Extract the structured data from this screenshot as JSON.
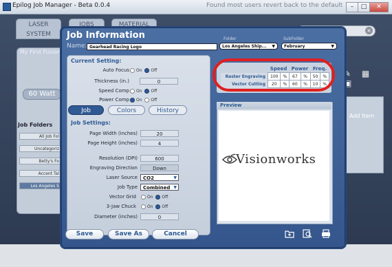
{
  "window": {
    "title": "Epilog Job Manager - Beta 0.0.4",
    "hint_text": "Found most users revert back to the default",
    "controls": {
      "minimize": "–",
      "maximize": "□",
      "close": "✕"
    }
  },
  "top_tabs": [
    {
      "line1": "LASER",
      "line2": "SYSTEM"
    },
    {
      "line1": "JOBS",
      "line2": ""
    },
    {
      "line1": "MATERIAL",
      "line2": ""
    }
  ],
  "background": {
    "side_tag": "My First Fusion",
    "watt_button": "60 Watt",
    "folders_title": "Job Folders",
    "folders": [
      "All Job Fol",
      "Uncategoriz",
      "Betty's Fo",
      "Accent Tal",
      "Los Angeles S"
    ],
    "right_text": "Add Item"
  },
  "dialog": {
    "title": "Job Information",
    "name_label": "Name:",
    "name_value": "Gearhead Racing Logo",
    "folder_label": "Folder",
    "folder_value": "Los Angeles Ship...",
    "subfolder_label": "SubFolder",
    "subfolder_value": "February",
    "current_setting": {
      "heading": "Current Setting:",
      "auto_focus": {
        "label": "Auto Focus",
        "on": "On",
        "off": "Off",
        "selected": "Off"
      },
      "thickness": {
        "label": "Thickness (in.)",
        "value": "0"
      },
      "speed_comp": {
        "label": "Speed Comp",
        "on": "On",
        "off": "Off",
        "selected": "Off"
      },
      "power_comp": {
        "label": "Power Comp",
        "on": "On",
        "off": "Off",
        "selected": "On"
      }
    },
    "tabs": [
      {
        "label": "Job",
        "active": true
      },
      {
        "label": "Colors",
        "active": false
      },
      {
        "label": "History",
        "active": false
      }
    ],
    "job_settings": {
      "heading": "Job Settings:",
      "page_width": {
        "label": "Page Width (inches)",
        "value": "20"
      },
      "page_height": {
        "label": "Page Height (inches)",
        "value": "4"
      },
      "resolution": {
        "label": "Resolution (DPI)",
        "value": "600"
      },
      "engraving_direction": {
        "label": "Engraving Direction",
        "value": "Down"
      },
      "laser_source": {
        "label": "Laser Source",
        "value": "CO2"
      },
      "job_type": {
        "label": "Job Type",
        "value": "Combined"
      },
      "vector_grid": {
        "label": "Vector Grid",
        "on": "On",
        "off": "Off",
        "selected": "Off"
      },
      "three_jaw_chuck": {
        "label": "3-Jaw Chuck",
        "on": "On",
        "off": "Off",
        "selected": "Off"
      },
      "diameter": {
        "label": "Diameter (inches)",
        "value": "0"
      }
    },
    "process_table": {
      "headers": [
        "",
        "Speed",
        "",
        "Power",
        "",
        "Freq.",
        ""
      ],
      "rows": [
        {
          "label": "Raster Engraving",
          "speed": "100",
          "speed_unit": "%",
          "power": "67",
          "power_unit": "%",
          "freq": "50",
          "freq_unit": "%"
        },
        {
          "label": "Vector Cutting",
          "speed": "20",
          "speed_unit": "%",
          "power": "60",
          "power_unit": "%",
          "freq": "10",
          "freq_unit": "%"
        }
      ]
    },
    "preview": {
      "heading": "Preview",
      "logo_text": "Visionworks"
    },
    "buttons": {
      "save": "Save",
      "save_as": "Save As",
      "cancel": "Cancel"
    },
    "highlight_color": "#e02020",
    "accent_color": "#2f5a93"
  }
}
